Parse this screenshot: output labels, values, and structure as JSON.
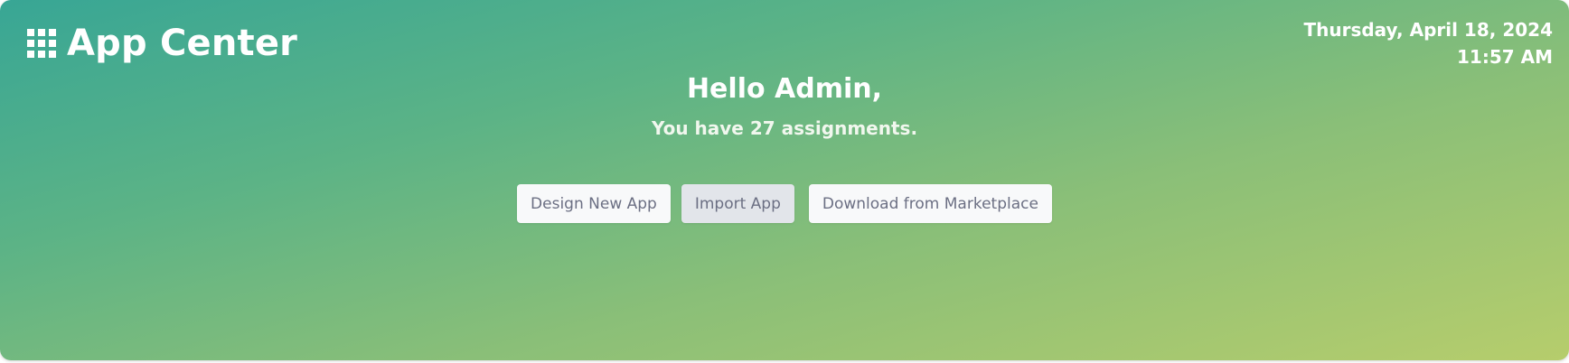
{
  "header": {
    "app_title": "App Center",
    "icon": "apps-grid-icon",
    "date": "Thursday, April 18, 2024",
    "time": "11:57 AM"
  },
  "welcome": {
    "greeting": "Hello Admin,",
    "message": "You have 27 assignments."
  },
  "actions": {
    "design_label": "Design New App",
    "import_label": "Import App",
    "marketplace_label": "Download from Marketplace"
  },
  "colors": {
    "gradient_start": "#38a695",
    "gradient_end": "#b6cd6c",
    "button_bg": "#f8f9fa",
    "button_active_bg": "#e2e5ea",
    "button_text": "#6b6f83"
  }
}
